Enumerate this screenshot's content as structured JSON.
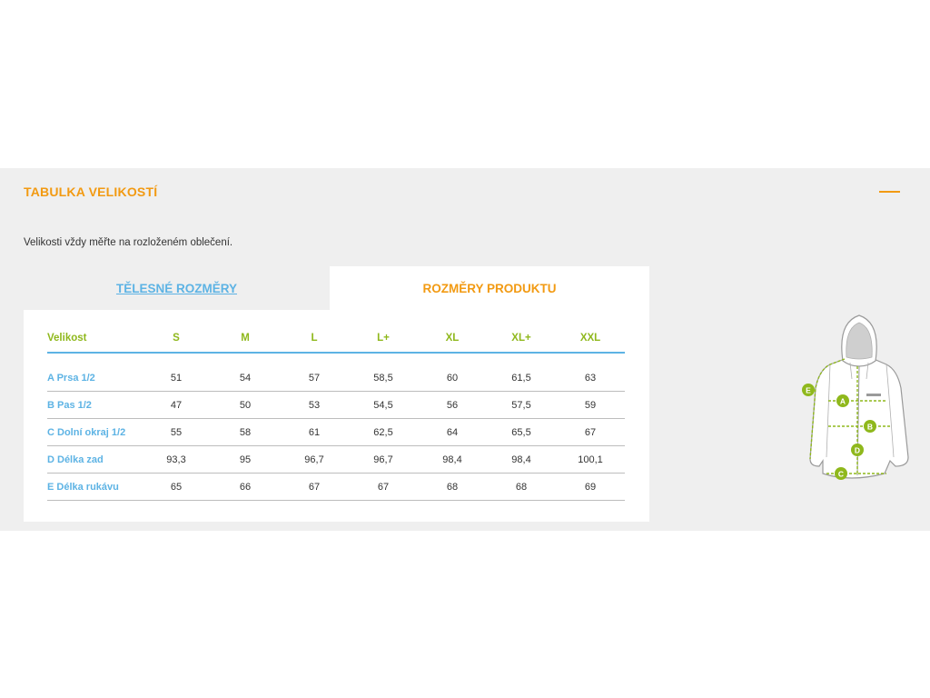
{
  "panel": {
    "title": "TABULKA VELIKOSTÍ",
    "collapse_icon": "minus-icon",
    "note": "Velikosti vždy měřte na rozloženém oblečení."
  },
  "tabs": [
    {
      "label": "TĚLESNÉ ROZMĚRY",
      "active": false
    },
    {
      "label": "ROZMĚRY PRODUKTU",
      "active": true
    }
  ],
  "table": {
    "header_label": "Velikost",
    "sizes": [
      "S",
      "M",
      "L",
      "L+",
      "XL",
      "XL+",
      "XXL"
    ],
    "rows": [
      {
        "label": "A Prsa 1/2",
        "values": [
          "51",
          "54",
          "57",
          "58,5",
          "60",
          "61,5",
          "63"
        ]
      },
      {
        "label": "B Pas 1/2",
        "values": [
          "47",
          "50",
          "53",
          "54,5",
          "56",
          "57,5",
          "59"
        ]
      },
      {
        "label": "C Dolní okraj 1/2",
        "values": [
          "55",
          "58",
          "61",
          "62,5",
          "64",
          "65,5",
          "67"
        ]
      },
      {
        "label": "D Délka zad",
        "values": [
          "93,3",
          "95",
          "96,7",
          "96,7",
          "98,4",
          "98,4",
          "100,1"
        ]
      },
      {
        "label": "E Délka rukávu",
        "values": [
          "65",
          "66",
          "67",
          "67",
          "68",
          "68",
          "69"
        ]
      }
    ]
  },
  "diagram": {
    "icon": "jacket-measurement-icon",
    "markers": [
      "A",
      "B",
      "C",
      "D",
      "E"
    ],
    "colors": {
      "marker": "#8fb81c",
      "outline": "#9a9a9a",
      "fill": "#ffffff"
    }
  },
  "colors": {
    "accent_orange": "#f29a12",
    "accent_blue": "#5db3e4",
    "accent_green": "#8fb81c",
    "panel_bg": "#efefef"
  }
}
